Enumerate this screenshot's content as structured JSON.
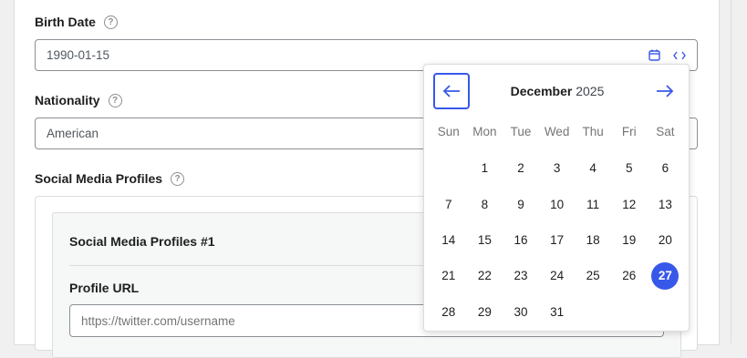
{
  "fields": {
    "birth_date": {
      "label": "Birth Date",
      "value": "1990-01-15"
    },
    "nationality": {
      "label": "Nationality",
      "value": "American"
    },
    "social_media": {
      "label": "Social Media Profiles"
    }
  },
  "help_glyph": "?",
  "repeater": {
    "item_title": "Social Media Profiles #1",
    "profile_url_label": "Profile URL",
    "profile_url_placeholder": "https://twitter.com/username"
  },
  "calendar": {
    "month": "December",
    "year": "2025",
    "weekdays": [
      "Sun",
      "Mon",
      "Tue",
      "Wed",
      "Thu",
      "Fri",
      "Sat"
    ],
    "first_weekday_index": 1,
    "days": [
      "1",
      "2",
      "3",
      "4",
      "5",
      "6",
      "7",
      "8",
      "9",
      "10",
      "11",
      "12",
      "13",
      "14",
      "15",
      "16",
      "17",
      "18",
      "19",
      "20",
      "21",
      "22",
      "23",
      "24",
      "25",
      "26",
      "27",
      "28",
      "29",
      "30",
      "31"
    ],
    "selected_day": "27"
  },
  "colors": {
    "accent": "#3858e9"
  },
  "icons": {
    "date_field": [
      "calendar-icon",
      "code-icon"
    ],
    "prev": "arrow-left-icon",
    "next": "arrow-right-icon"
  }
}
